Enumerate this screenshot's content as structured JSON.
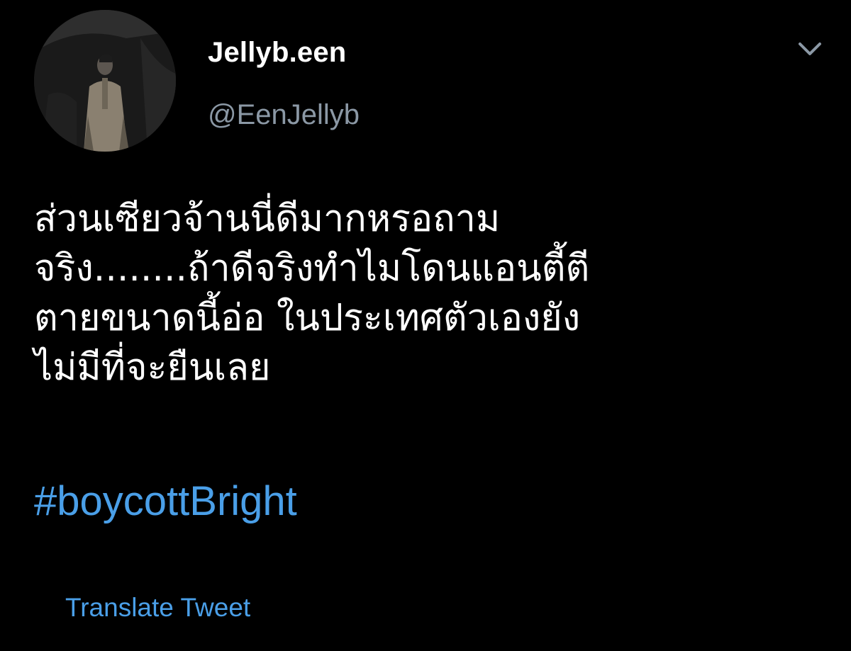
{
  "author": {
    "display_name": "Jellyb.een",
    "handle": "@EenJellyb"
  },
  "tweet": {
    "lines": [
      "ส่วนเซียวจ้านนี่ดีมากหรอถาม",
      "จริง........ถ้าดีจริงทำไมโดนแอนตี้ตี",
      "ตายขนาดนี้อ่อ ในประเทศตัวเองยัง",
      "ไม่มีที่จะยืนเลย"
    ],
    "hashtag": "#boycottBright"
  },
  "actions": {
    "translate_label": "Translate Tweet"
  },
  "icons": {
    "menu": "chevron-down-icon",
    "avatar": "avatar-image"
  },
  "colors": {
    "background": "#000000",
    "text": "#ffffff",
    "secondary_text": "#8b98a5",
    "link": "#4a9fe8"
  }
}
